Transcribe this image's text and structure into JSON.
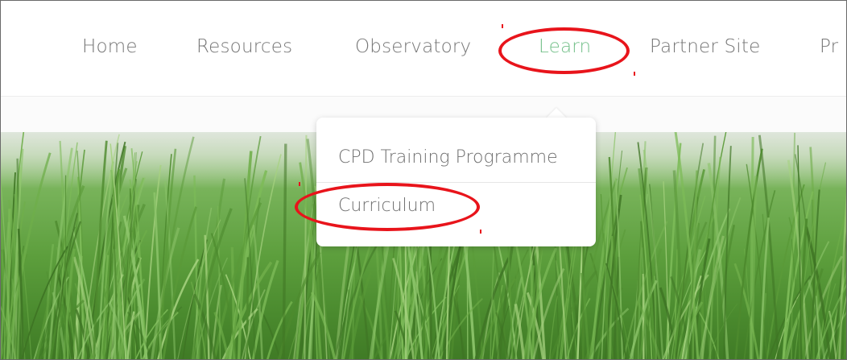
{
  "nav": {
    "items": [
      {
        "label": "Home"
      },
      {
        "label": "Resources"
      },
      {
        "label": "Observatory"
      },
      {
        "label": "Learn",
        "active": true
      },
      {
        "label": "Partner Site"
      },
      {
        "label": "Pr"
      }
    ],
    "active_color": "#74c08a",
    "text_color": "#767676"
  },
  "dropdown": {
    "items": [
      {
        "label": "CPD Training Programme"
      },
      {
        "label": "Curriculum"
      }
    ]
  },
  "annotation_color": "#e8141b",
  "hero": {
    "icon": "grass-field-image"
  }
}
